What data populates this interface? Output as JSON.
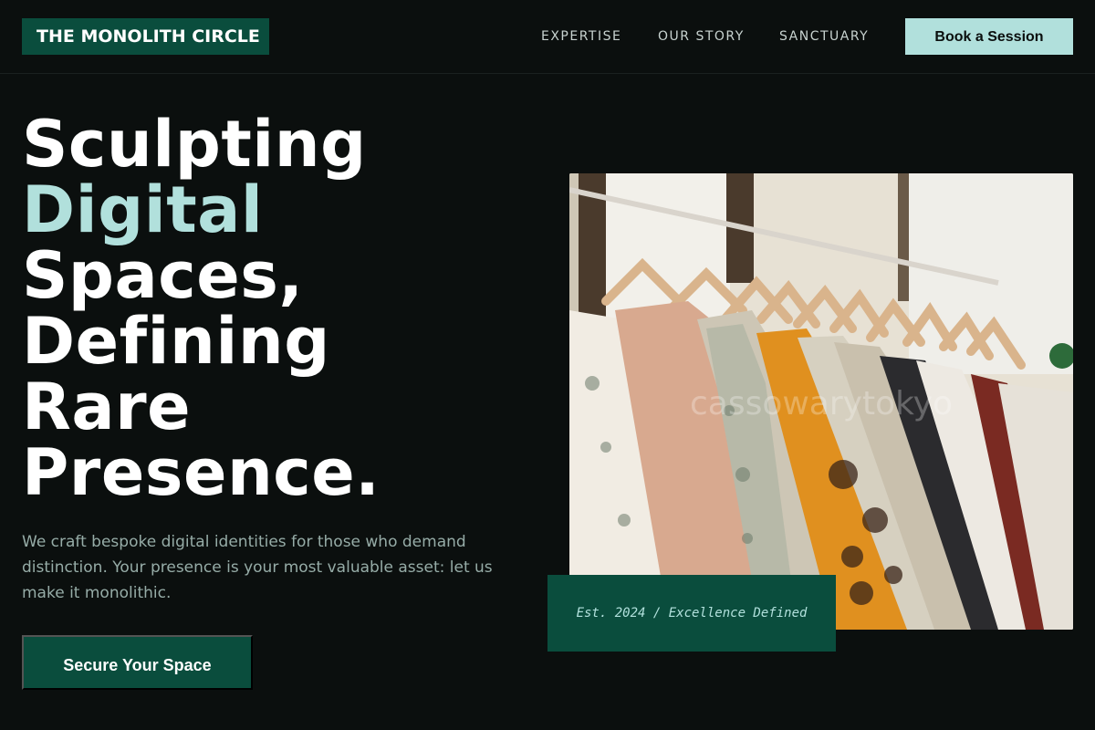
{
  "header": {
    "logo": "THE MONOLITH CIRCLE",
    "nav": [
      "EXPERTISE",
      "OUR STORY",
      "SANCTUARY"
    ],
    "cta_label": "Book a Session"
  },
  "hero": {
    "headline_lines": [
      "Sculpting",
      "Digital",
      "Spaces,",
      "Defining",
      "Rare",
      "Presence."
    ],
    "paragraph": "We craft bespoke digital identities for those who demand distinction. Your presence is your most valuable asset: let us make it monolithic.",
    "cta_label": "Secure Your Space",
    "image_watermark": "cassowarytokyo",
    "badge": "Est. 2024 / Excellence Defined"
  },
  "colors": {
    "background": "#0b0f0e",
    "brand_green": "#0a4d3d",
    "accent_mint": "#b1e0dc",
    "body_text": "#96aca7"
  },
  "icons": [
    "clothing-rack-photo"
  ]
}
